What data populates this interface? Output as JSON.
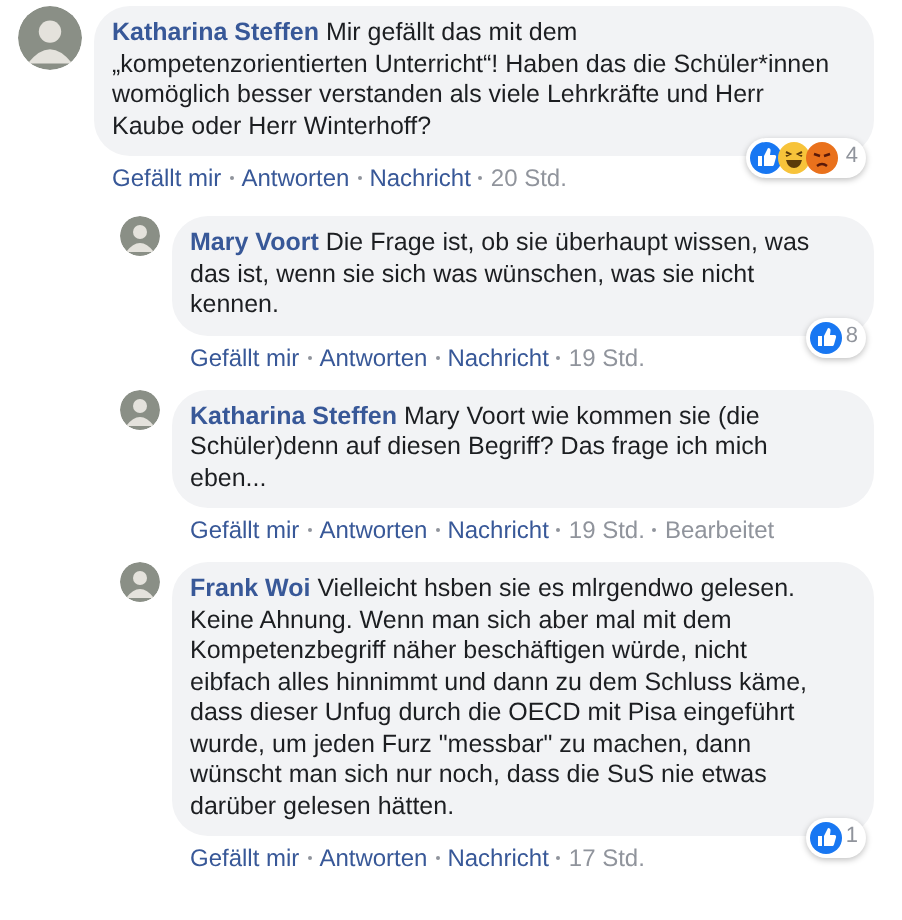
{
  "comments": [
    {
      "kind": "comment",
      "author": "Katharina Steffen",
      "text": "Mir gefällt das mit dem „kompetenzorientierten Unterricht“! Haben das die Schüler*innen womöglich besser verstanden als viele Lehrkräfte und Herr Kaube oder Herr Winterhoff?",
      "reactions": [
        {
          "kind": "like"
        },
        {
          "kind": "haha"
        },
        {
          "kind": "angry"
        }
      ],
      "reaction_count": "4",
      "actions": [
        "Gefällt mir",
        "Antworten",
        "Nachricht"
      ],
      "time": "20 Std."
    },
    {
      "kind": "reply",
      "author": "Mary Voort",
      "text": "Die Frage ist, ob sie überhaupt wissen, was das ist, wenn sie sich was wünschen, was sie nicht kennen.",
      "reactions": [
        {
          "kind": "like"
        }
      ],
      "reaction_count": "8",
      "actions": [
        "Gefällt mir",
        "Antworten",
        "Nachricht"
      ],
      "time": "19 Std."
    },
    {
      "kind": "reply",
      "author": "Katharina Steffen",
      "text": "Mary Voort wie kommen sie (die Schüler)denn auf diesen Begriff? Das frage ich mich eben...",
      "actions": [
        "Gefällt mir",
        "Antworten",
        "Nachricht"
      ],
      "time": "19 Std.",
      "edited": "Bearbeitet"
    },
    {
      "kind": "reply",
      "author": "Frank Woi",
      "text": "Vielleicht hsben sie es mlrgendwo gelesen. Keine Ahnung. Wenn man sich aber mal mit dem Kompetenzbegriff näher beschäftigen würde, nicht eibfach alles hinnimmt und dann zu dem Schluss käme, dass dieser Unfug durch die OECD mit Pisa eingeführt wurde, um jeden Furz \"messbar\" zu machen, dann wünscht man sich nur noch, dass die SuS nie etwas darüber gelesen hätten.",
      "reactions": [
        {
          "kind": "like"
        }
      ],
      "reaction_count": "1",
      "actions": [
        "Gefällt mir",
        "Antworten",
        "Nachricht"
      ],
      "time": "17 Std."
    }
  ]
}
